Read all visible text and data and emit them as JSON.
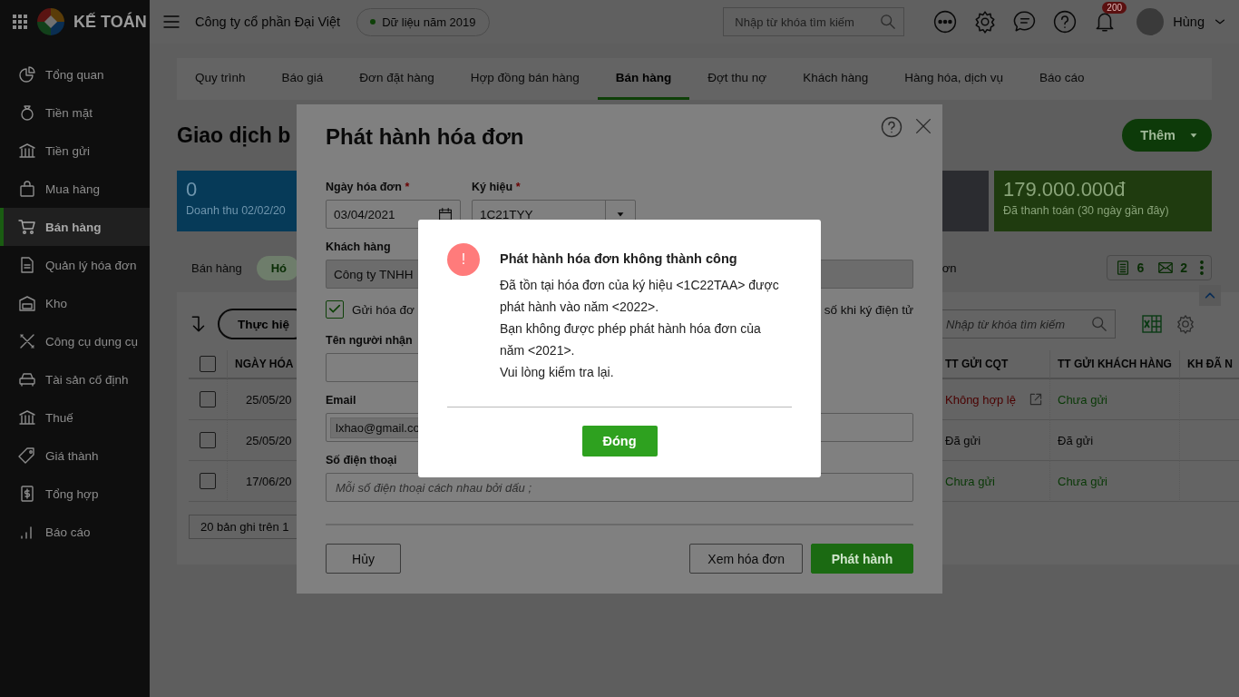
{
  "sidebar": {
    "brand": "KẾ TOÁN",
    "items": [
      {
        "label": "Tổng quan",
        "selected": false
      },
      {
        "label": "Tiền mặt",
        "selected": false
      },
      {
        "label": "Tiền gửi",
        "selected": false
      },
      {
        "label": "Mua hàng",
        "selected": false
      },
      {
        "label": "Bán hàng",
        "selected": true
      },
      {
        "label": "Quản lý hóa đơn",
        "selected": false
      },
      {
        "label": "Kho",
        "selected": false
      },
      {
        "label": "Công cụ dụng cụ",
        "selected": false
      },
      {
        "label": "Tài sản cố định",
        "selected": false
      },
      {
        "label": "Thuế",
        "selected": false
      },
      {
        "label": "Giá thành",
        "selected": false
      },
      {
        "label": "Tổng hợp",
        "selected": false
      },
      {
        "label": "Báo cáo",
        "selected": false
      }
    ]
  },
  "topbar": {
    "company": "Công ty cổ phần Đại Việt",
    "data_year": "Dữ liệu năm 2019",
    "search": {
      "placeholder": "Nhập từ khóa tìm kiếm"
    },
    "notification_count": "200",
    "user": "Hùng"
  },
  "tabs": [
    {
      "label": "Quy trình",
      "selected": false
    },
    {
      "label": "Báo giá",
      "selected": false
    },
    {
      "label": "Đơn đặt hàng",
      "selected": false
    },
    {
      "label": "Hợp đồng bán hàng",
      "selected": false
    },
    {
      "label": "Bán hàng",
      "selected": true
    },
    {
      "label": "Đợt thu nợ",
      "selected": false
    },
    {
      "label": "Khách hàng",
      "selected": false
    },
    {
      "label": "Hàng hóa, dịch vụ",
      "selected": false
    },
    {
      "label": "Báo cáo",
      "selected": false
    }
  ],
  "page": {
    "title": "Giao dịch b",
    "add_button": "Thêm",
    "cards": [
      {
        "value": "0",
        "label": "Doanh thu 02/02/20",
        "color": "#063a58"
      },
      {
        "color": "#2b2c30"
      },
      {
        "value": "179.000.000đ",
        "label": "Đã thanh toán (30 ngày gần đây)",
        "color": "#1f3b0f"
      }
    ],
    "filters": [
      {
        "label": "Bán hàng",
        "selected": false
      },
      {
        "label": "Hó",
        "selected": true
      }
    ],
    "filter_tail": "ơn",
    "invoice_count": "6",
    "mail_count": "2"
  },
  "table": {
    "action_button": "Thực hiệ",
    "search": {
      "placeholder": "Nhập từ khóa tìm kiếm"
    },
    "select_all": {
      "checked": false
    },
    "columns": [
      "NGÀY HÓA",
      "TT GỬI CQT",
      "TT GỬI KHÁCH HÀNG",
      "KH ĐÃ N"
    ],
    "rows": [
      {
        "checked": false,
        "date": "25/05/20",
        "cqt": {
          "text": "Không hợp lệ",
          "kind": "invalid",
          "link": true
        },
        "customer": {
          "text": "Chưa gửi",
          "kind": "pending"
        }
      },
      {
        "checked": false,
        "date": "25/05/20",
        "cqt": {
          "text": "Đã gửi",
          "kind": "sent",
          "link": false
        },
        "customer": {
          "text": "Đã gửi",
          "kind": "sent"
        }
      },
      {
        "checked": false,
        "date": "17/06/20",
        "cqt": {
          "text": "Chưa gửi",
          "kind": "pending",
          "link": false
        },
        "customer": {
          "text": "Chưa gửi",
          "kind": "pending"
        }
      }
    ],
    "footer": "20 bản ghi trên 1"
  },
  "dialog": {
    "title": "Phát hành hóa đơn",
    "invoice_date": {
      "label": "Ngày hóa đơn",
      "required_mark": "*",
      "value": "03/04/2021"
    },
    "symbol": {
      "label": "Ký hiệu",
      "required_mark": "*",
      "value": "1C21TYY"
    },
    "customer": {
      "label": "Khách hàng",
      "value": "Công ty TNHH",
      "disabled": true
    },
    "send_invoice": {
      "label": "Gửi hóa đơ",
      "tail": "số khi ký điện tử",
      "checked": true
    },
    "recipient": {
      "label": "Tên người nhận"
    },
    "email": {
      "label": "Email",
      "chips": [
        "lxhao@gmail.co"
      ]
    },
    "phone": {
      "label": "Số điện thoại",
      "placeholder": "Mỗi số điện thoại cách nhau bởi dấu ;"
    },
    "buttons": {
      "cancel": "Hủy",
      "preview": "Xem hóa đơn",
      "issue": "Phát hành"
    }
  },
  "alert": {
    "title": "Phát hành hóa đơn không thành công",
    "icon": "!",
    "lines": [
      "Đã tồn tại hóa đơn của ký hiệu <1C22TAA> được phát hành vào năm <2022>.",
      "Bạn không được phép phát hành hóa đơn của năm <2021>.",
      "Vui lòng kiểm tra lại."
    ],
    "button": "Đóng"
  }
}
